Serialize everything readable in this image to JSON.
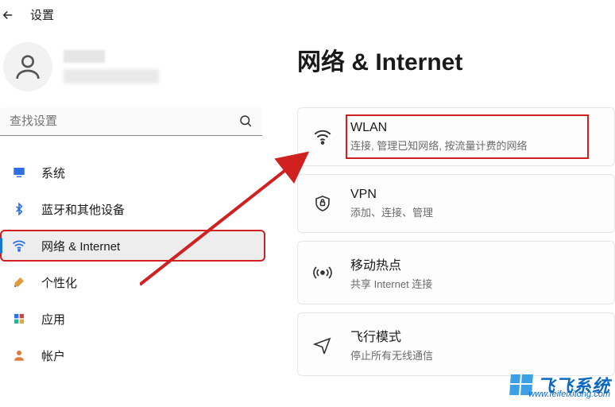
{
  "header": {
    "title": "设置"
  },
  "search": {
    "placeholder": "查找设置"
  },
  "nav": {
    "items": [
      {
        "label": "系统"
      },
      {
        "label": "蓝牙和其他设备"
      },
      {
        "label": "网络 & Internet"
      },
      {
        "label": "个性化"
      },
      {
        "label": "应用"
      },
      {
        "label": "帐户"
      }
    ]
  },
  "main": {
    "heading": "网络 & Internet",
    "cards": [
      {
        "title": "WLAN",
        "subtitle": "连接, 管理已知网络, 按流量计费的网络"
      },
      {
        "title": "VPN",
        "subtitle": "添加、连接、管理"
      },
      {
        "title": "移动热点",
        "subtitle": "共享 Internet 连接"
      },
      {
        "title": "飞行模式",
        "subtitle": "停止所有无线通信"
      }
    ]
  },
  "watermark": {
    "brand": "飞飞系统",
    "url": "www.feifeixitong.com"
  }
}
